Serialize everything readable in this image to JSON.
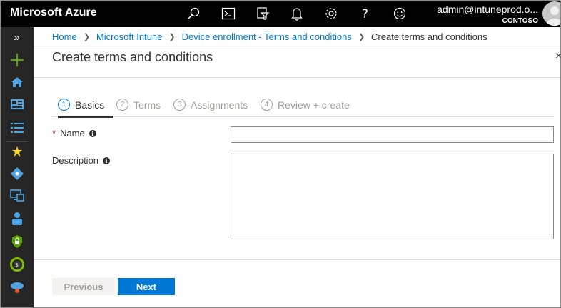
{
  "app": {
    "brand": "Microsoft Azure",
    "user": "admin@intuneprod.o...",
    "tenant": "CONTOSO"
  },
  "topbar_icons": [
    "search-icon",
    "cloud-shell-icon",
    "directory-filter-icon",
    "notifications-icon",
    "settings-icon",
    "help-icon",
    "feedback-icon"
  ],
  "rail": {
    "expand_label": "»",
    "items": [
      "create-resource-icon",
      "home-icon",
      "dashboard-icon",
      "all-services-icon",
      "favorites-star-icon",
      "azure-ad-icon",
      "devices-icon",
      "users-icon",
      "security-icon",
      "cost-icon",
      "cloud-icon"
    ]
  },
  "breadcrumb": {
    "items": [
      "Home",
      "Microsoft Intune",
      "Device enrollment - Terms and conditions"
    ],
    "current": "Create terms and conditions"
  },
  "blade": {
    "title": "Create terms and conditions",
    "close_label": "×"
  },
  "tabs": [
    {
      "num": "1",
      "label": "Basics"
    },
    {
      "num": "2",
      "label": "Terms"
    },
    {
      "num": "3",
      "label": "Assignments"
    },
    {
      "num": "4",
      "label": "Review + create"
    }
  ],
  "form": {
    "name_label": "Name",
    "required_marker": "*",
    "name_value": "",
    "description_label": "Description",
    "description_value": "",
    "info_glyph": "i"
  },
  "footer": {
    "previous_label": "Previous",
    "next_label": "Next"
  },
  "colors": {
    "accent": "#0078d4",
    "topbar": "#000000",
    "rail": "#262626"
  }
}
